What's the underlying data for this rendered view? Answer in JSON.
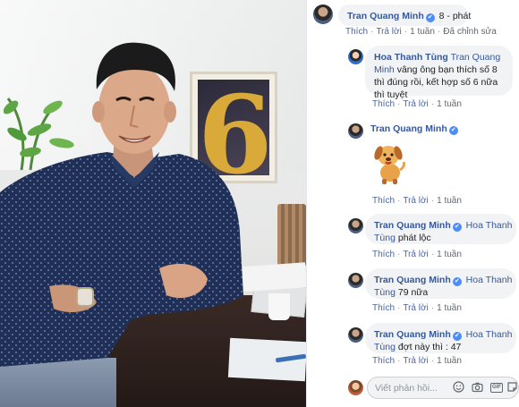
{
  "comments": [
    {
      "author": "Tran Quang Minh",
      "text": "8 - phát",
      "actions": {
        "like": "Thích",
        "reply": "Trả lời",
        "time": "1 tuần",
        "edited": "Đã chỉnh sửa"
      }
    },
    {
      "author": "Hoa Thanh Tùng",
      "tag": "Tran Quang Minh",
      "text": "vâng ông bạn thích số 8 thì đúng rồi, kết hợp số 6 nữa thì tuyệt",
      "actions": {
        "like": "Thích",
        "reply": "Trả lời",
        "time": "1 tuần"
      }
    },
    {
      "author": "Tran Quang Minh",
      "sticker": "dog-sticker",
      "actions": {
        "like": "Thích",
        "reply": "Trả lời",
        "time": "1 tuần"
      }
    },
    {
      "author": "Tran Quang Minh",
      "tag_line1": "Hoa Thanh",
      "tag_line2": "Tùng",
      "text": "phát lộc",
      "actions": {
        "like": "Thích",
        "reply": "Trả lời",
        "time": "1 tuần"
      }
    },
    {
      "author": "Tran Quang Minh",
      "tag_line1": "Hoa Thanh",
      "tag_line2": "Tùng",
      "text": "79 nữa",
      "actions": {
        "like": "Thích",
        "reply": "Trả lời",
        "time": "1 tuần"
      }
    },
    {
      "author": "Tran Quang Minh",
      "tag_line1": "Hoa Thanh",
      "tag_line2": "Tùng",
      "text": "đợt này thì : 47",
      "actions": {
        "like": "Thích",
        "reply": "Trả lời",
        "time": "1 tuần"
      }
    }
  ],
  "reply_box": {
    "placeholder": "Viết phản hồi...",
    "icons": [
      "emoji-icon",
      "camera-icon",
      "gif-icon",
      "sticker-icon"
    ]
  },
  "colors": {
    "name": "#385898",
    "verified": "#4c8df6",
    "bubble": "#f2f3f5",
    "meta": "#606770"
  }
}
